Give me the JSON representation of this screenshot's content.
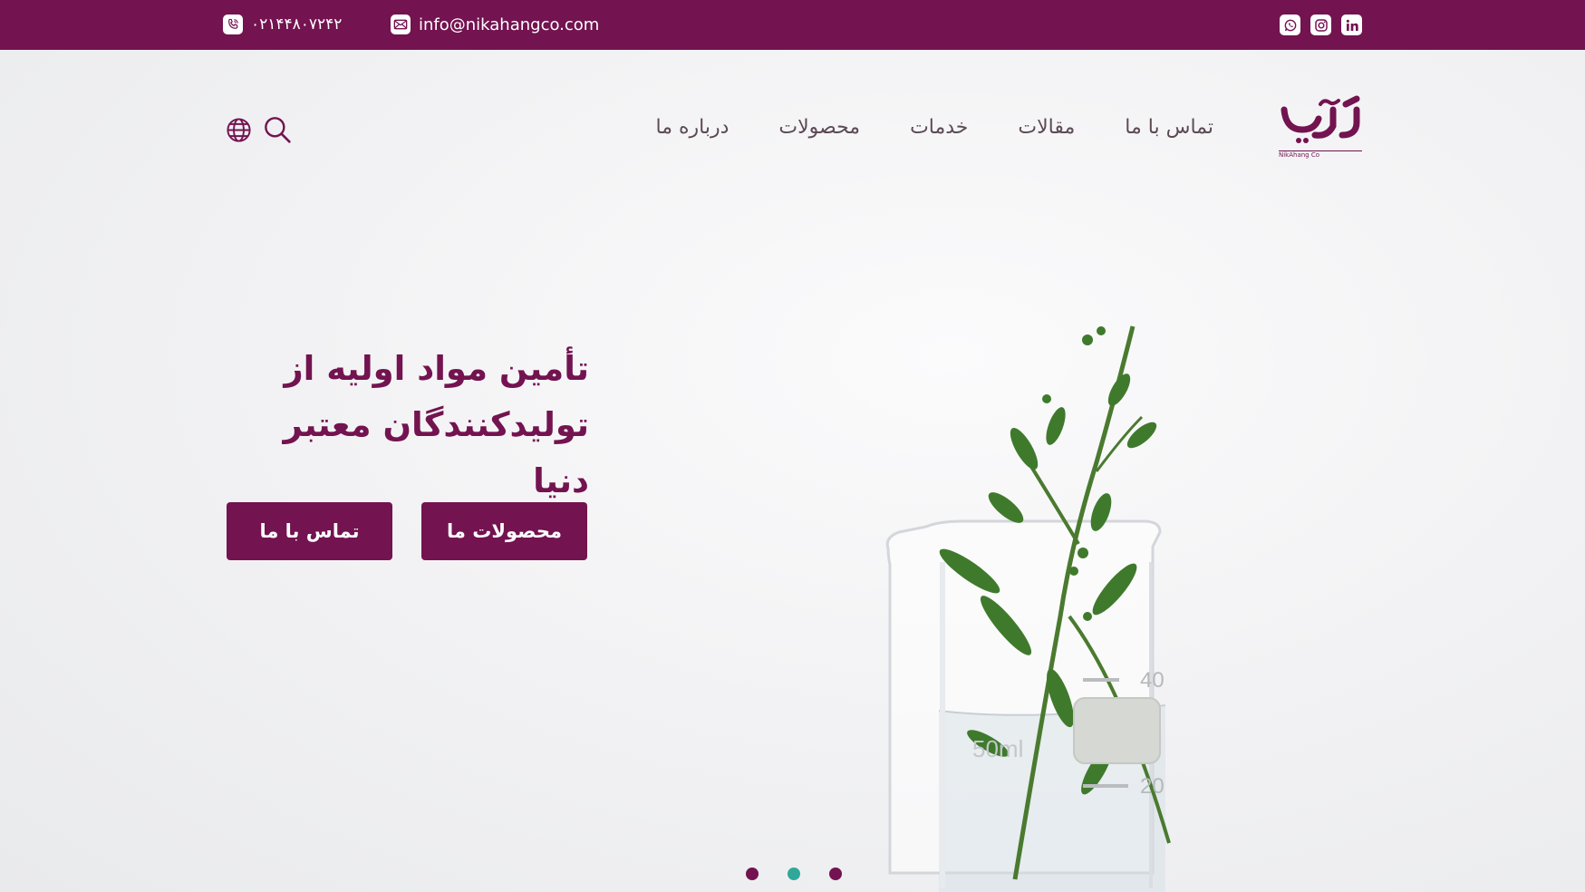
{
  "topbar": {
    "phone": "۰۲۱۴۴۸۰۷۲۴۲",
    "email": "info@nikahangco.com",
    "phone_icon": "phone-icon",
    "email_icon": "mail-icon",
    "social": [
      "whatsapp-icon",
      "instagram-icon",
      "linkedin-icon"
    ]
  },
  "brand": {
    "logo_caption": "NikAhang Co",
    "color": "#731350",
    "accent": "#2fa89a"
  },
  "nav": {
    "items": [
      {
        "label": "درباره ما"
      },
      {
        "label": "محصولات"
      },
      {
        "label": "خدمات"
      },
      {
        "label": "مقالات"
      },
      {
        "label": "تماس با ما"
      }
    ],
    "search_icon": "search-icon",
    "language_icon": "globe-icon"
  },
  "hero": {
    "title_line1": "تأمین مواد اولیه از",
    "title_line2": "تولیدکنندگان معتبر دنیا",
    "btn_products": "محصولات ما",
    "btn_contact": "تماس با ما",
    "beaker_marks": [
      "40",
      "50ml",
      "20"
    ]
  },
  "slider": {
    "count": 3,
    "active_index": 1
  }
}
